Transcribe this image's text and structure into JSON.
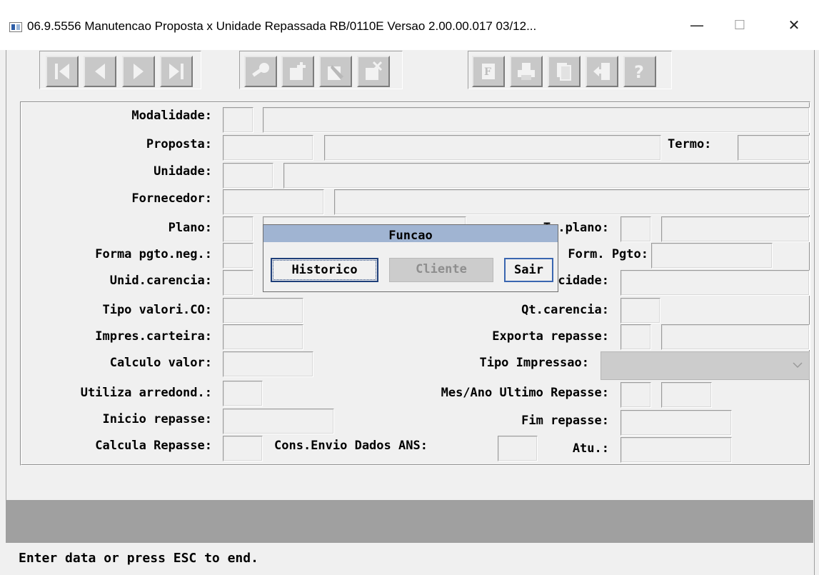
{
  "window": {
    "title": "06.9.5556 Manutencao  Proposta x Unidade Repassada RB/0110E Versao 2.00.00.017 03/12...",
    "minimize_glyph": "—",
    "maximize_glyph": "☐",
    "close_glyph": "✕"
  },
  "toolbar": {
    "nav": [
      "first-record-icon",
      "previous-record-icon",
      "next-record-icon",
      "last-record-icon"
    ],
    "edit": [
      "search-key-icon",
      "add-record-icon",
      "modify-record-icon",
      "delete-record-icon"
    ],
    "tools": [
      "filter-f-icon",
      "print-icon",
      "copy-pages-icon",
      "exit-door-icon",
      "help-question-icon"
    ]
  },
  "form": {
    "modalidade": "Modalidade:",
    "proposta": "Proposta:",
    "termo": "Termo:",
    "unidade": "Unidade:",
    "fornecedor": "Fornecedor:",
    "plano": "Plano:",
    "tp_plano": "Tp.plano:",
    "forma_pgto": "Forma pgto.neg.:",
    "form_pgto": "Form. Pgto:",
    "unid_carencia": "Unid.carencia:",
    "periodicidade": "Periodicidade:",
    "tipo_valori": "Tipo valori.CO:",
    "qt_carencia": "Qt.carencia:",
    "impres_carteira": "Impres.carteira:",
    "exporta_repasse": "Exporta repasse:",
    "calculo_valor": "Calculo valor:",
    "tipo_impressao": "Tipo Impressao:",
    "utiliza_arredond": "Utiliza arredond.:",
    "mes_ano_ultimo": "Mes/Ano Ultimo Repasse:",
    "inicio_repasse": "Inicio repasse:",
    "fim_repasse": "Fim repasse:",
    "calcula_repasse": "Calcula Repasse:",
    "cons_envio": "Cons.Envio Dados ANS:",
    "atu": "Atu.:"
  },
  "dialog": {
    "title": "Funcao",
    "buttons": {
      "historico": "Historico",
      "cliente": "Cliente",
      "sair": "Sair"
    }
  },
  "status": {
    "message": "Enter data or press ESC to end."
  }
}
